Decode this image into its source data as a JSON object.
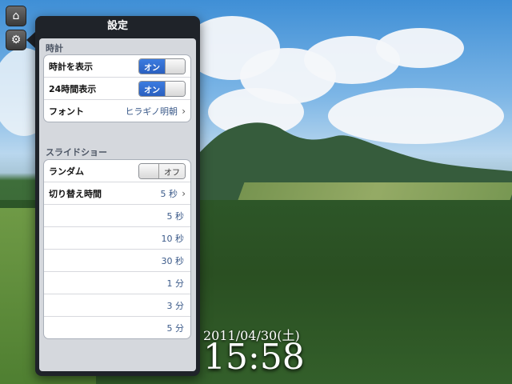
{
  "popover": {
    "title": "設定",
    "sections": {
      "clock": {
        "header": "時計",
        "show_clock": {
          "label": "時計を表示",
          "toggle": "オン"
        },
        "hour24": {
          "label": "24時間表示",
          "toggle": "オン"
        },
        "font": {
          "label": "フォント",
          "value": "ヒラギノ明朝"
        }
      },
      "slideshow": {
        "header": "スライドショー",
        "random": {
          "label": "ランダム",
          "toggle": "オフ"
        },
        "interval": {
          "label": "切り替え時間",
          "value": "5 秒"
        },
        "options": [
          "5 秒",
          "10 秒",
          "30 秒",
          "1 分",
          "3 分",
          "5 分"
        ]
      }
    }
  },
  "clock": {
    "date": "2011/04/30(土)",
    "time": "15:58"
  },
  "icons": {
    "home": "home-icon",
    "settings": "gear-icon"
  }
}
